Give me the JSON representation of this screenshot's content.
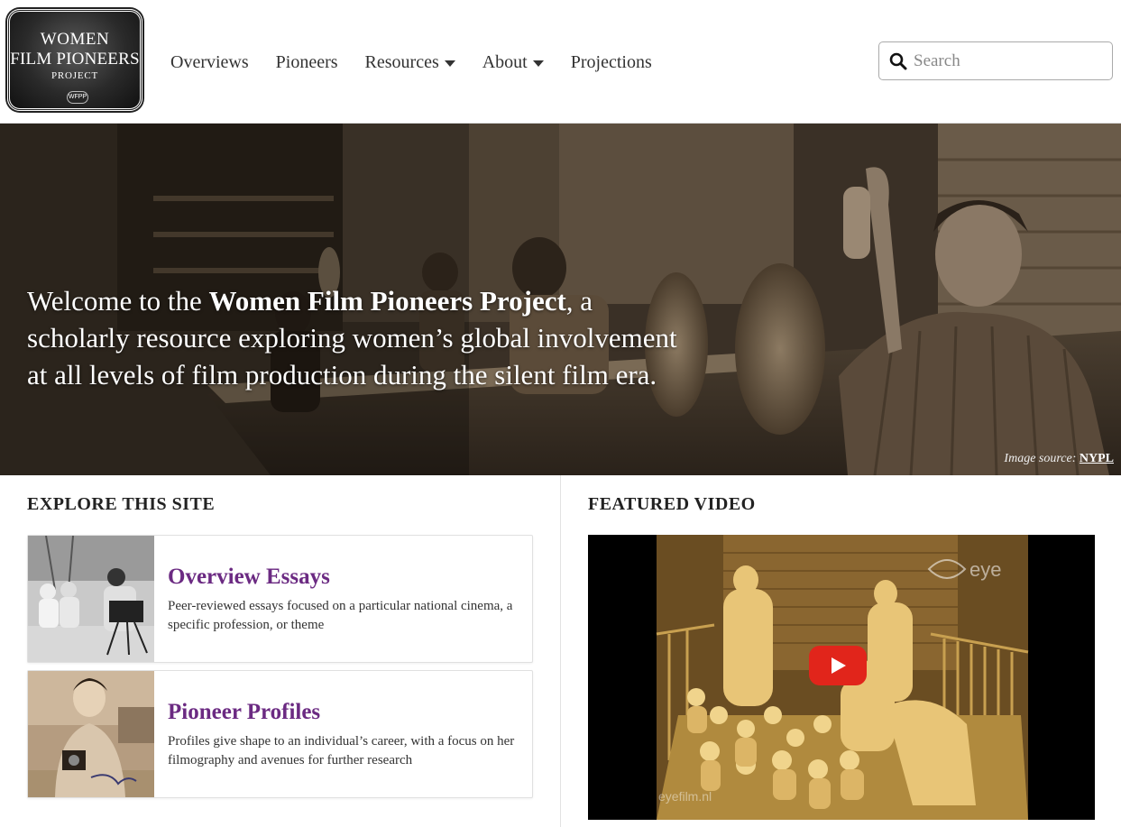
{
  "logo": {
    "line1": "WOMEN",
    "line2": "FILM PIONEERS",
    "line3": "PROJECT",
    "seal": "WFPP"
  },
  "nav": {
    "items": [
      {
        "label": "Overviews",
        "dropdown": false
      },
      {
        "label": "Pioneers",
        "dropdown": false
      },
      {
        "label": "Resources",
        "dropdown": true
      },
      {
        "label": "About",
        "dropdown": true
      },
      {
        "label": "Projections",
        "dropdown": false
      }
    ]
  },
  "search": {
    "placeholder": "Search",
    "value": ""
  },
  "hero": {
    "intro": "Welcome to the ",
    "project_name": "Women Film Pioneers Project",
    "rest": ", a scholarly resource exploring women’s global involvement at all levels of film production during the silent film era.",
    "credit_label": "Image source: ",
    "credit_link": "NYPL"
  },
  "explore": {
    "title": "EXPLORE THIS SITE",
    "cards": [
      {
        "title": "Overview Essays",
        "description": "Peer-reviewed essays focused on a particular national cinema, a specific profession, or theme"
      },
      {
        "title": "Pioneer Profiles",
        "description": "Profiles give shape to an individual’s career, with a focus on her filmography and avenues for further research"
      }
    ]
  },
  "featured": {
    "title": "FEATURED VIDEO",
    "watermark": "eye",
    "watermark_site": "eyefilm.nl"
  },
  "colors": {
    "accent_purple": "#6b2a82",
    "play_red": "#e1251b"
  }
}
